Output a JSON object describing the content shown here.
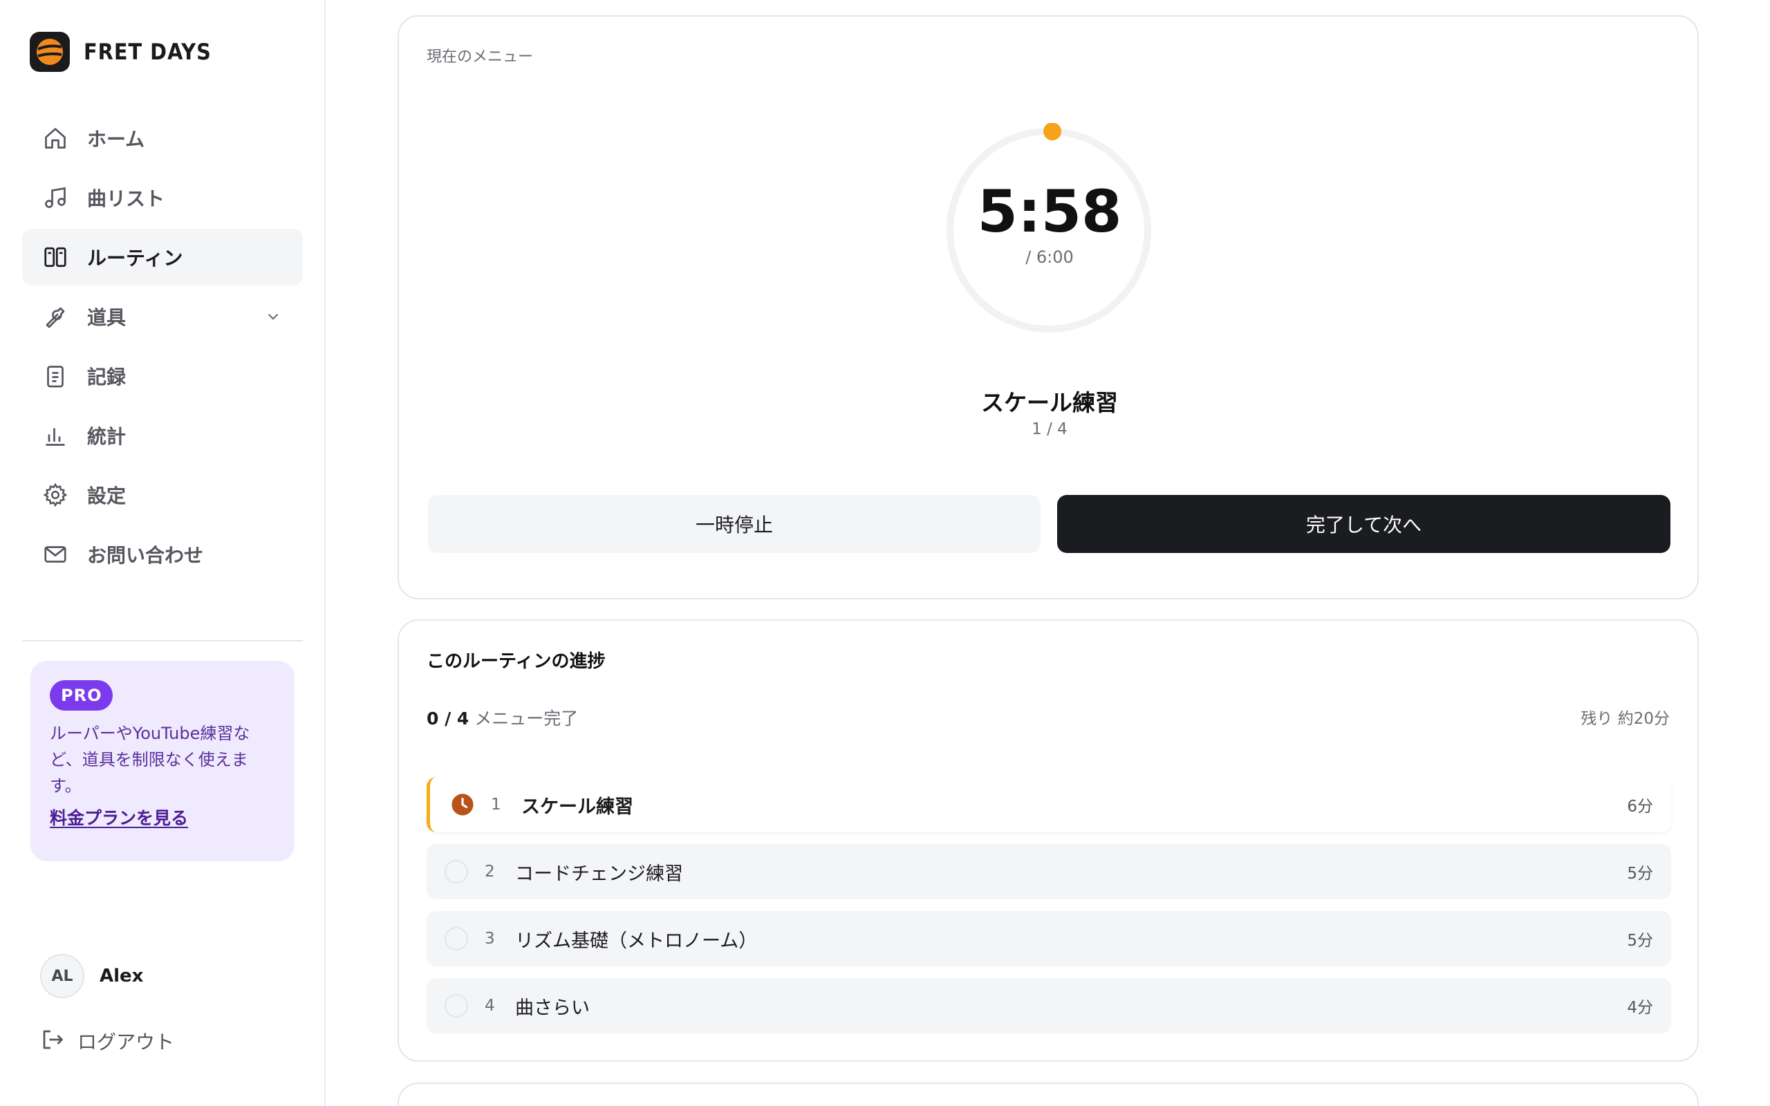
{
  "brand": {
    "name": "FRET DAYS"
  },
  "nav": {
    "items": [
      {
        "label": "ホーム",
        "icon": "home-icon"
      },
      {
        "label": "曲リスト",
        "icon": "music-note-icon"
      },
      {
        "label": "ルーティン",
        "icon": "routine-icon",
        "active": true
      },
      {
        "label": "道具",
        "icon": "wrench-icon",
        "expandable": true
      },
      {
        "label": "記録",
        "icon": "clipboard-icon"
      },
      {
        "label": "統計",
        "icon": "bar-chart-icon"
      },
      {
        "label": "設定",
        "icon": "gear-icon"
      },
      {
        "label": "お問い合わせ",
        "icon": "mail-icon"
      }
    ]
  },
  "pro": {
    "badge": "PRO",
    "text": "ルーパーやYouTube練習など、道具を制限なく使えます。",
    "link": "料金プランを見る"
  },
  "user": {
    "initials": "AL",
    "name": "Alex"
  },
  "logout": {
    "label": "ログアウト"
  },
  "timer": {
    "label": "現在のメニュー",
    "time": "5:58",
    "total": "/ 6:00",
    "progress_fraction": 0.0056,
    "title": "スケール練習",
    "count": "1 / 4",
    "pause_label": "一時停止",
    "next_label": "完了して次へ"
  },
  "progress": {
    "title": "このルーティンの進捗",
    "done": "0 / 4",
    "done_suffix": "メニュー完了",
    "remaining": "残り 約20分",
    "items": [
      {
        "num": "1",
        "name": "スケール練習",
        "duration": "6分",
        "current": true
      },
      {
        "num": "2",
        "name": "コードチェンジ練習",
        "duration": "5分"
      },
      {
        "num": "3",
        "name": "リズム基礎（メトロノーム）",
        "duration": "5分"
      },
      {
        "num": "4",
        "name": "曲さらい",
        "duration": "4分"
      }
    ]
  },
  "colors": {
    "accent": "#f6a21b",
    "pro": "#7c3aed",
    "primary_button": "#1b1c20"
  }
}
